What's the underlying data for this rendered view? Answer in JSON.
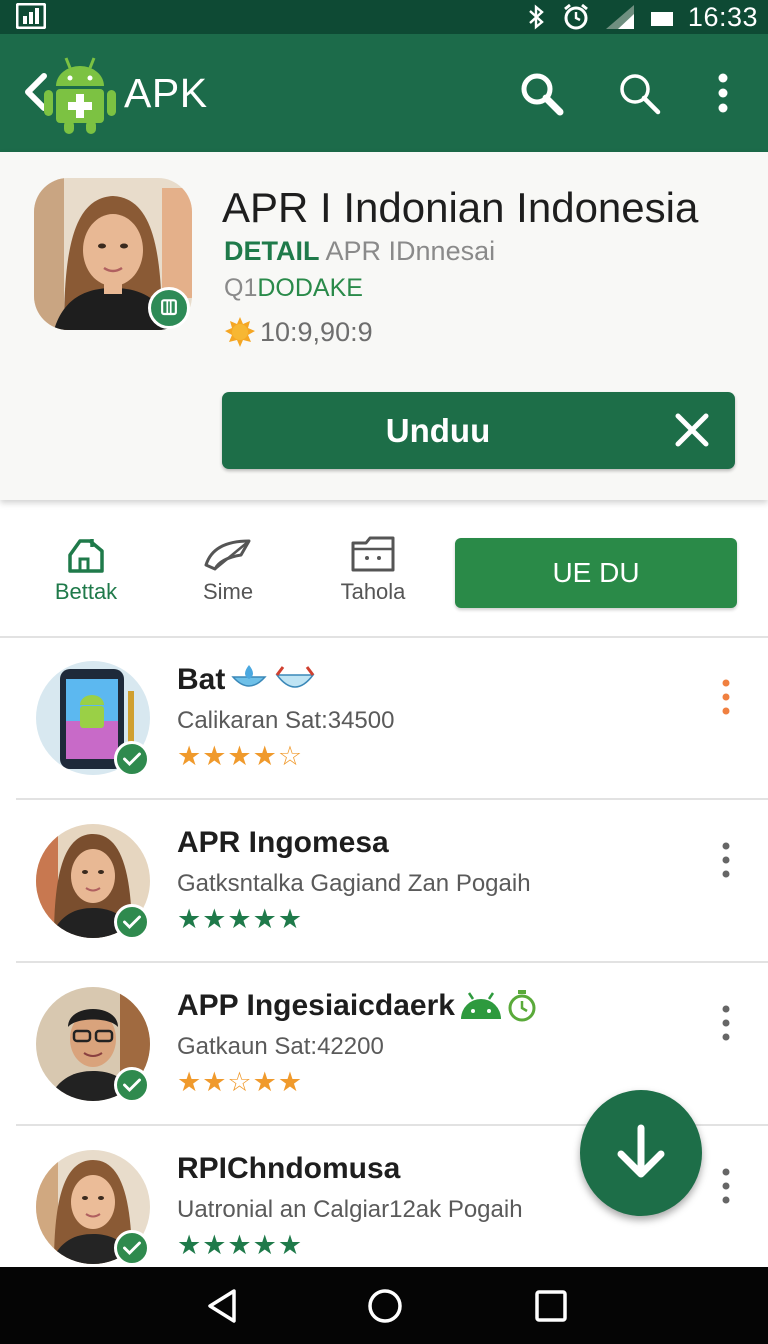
{
  "status_bar": {
    "time": "16:33",
    "icons": [
      "gallery-icon",
      "bluetooth-icon",
      "alarm-icon",
      "signal-icon",
      "battery-icon"
    ]
  },
  "app_bar": {
    "title": "APK",
    "icons": [
      "back-icon",
      "android-logo-icon",
      "search-icon",
      "search-icon",
      "more-vert-icon"
    ]
  },
  "detail": {
    "app_name": "APR I Indonian Indonesia",
    "detail_label": "DETAIL",
    "detail_sub": "APR IDnnesai",
    "version_prefix": "Q1",
    "version_label": "DODAKE",
    "size": "10:9,90:9",
    "download_button": "Unduu"
  },
  "tabs": [
    {
      "label": "Bettak",
      "icon": "home-icon"
    },
    {
      "label": "Sime",
      "icon": "send-icon"
    },
    {
      "label": "Tahola",
      "icon": "folder-icon"
    }
  ],
  "action_button": "UE DU",
  "list": [
    {
      "title": "Bat",
      "subtitle": "Calikaran Sat:34500",
      "stars": "★★★★☆",
      "rating": 4
    },
    {
      "title": "APR Ingomesa",
      "subtitle": "Gatksntalka Gagiand Zan Pogaih",
      "stars": "★★★★★",
      "rating": 5
    },
    {
      "title": "APP Ingesiaicdaerk",
      "subtitle": "Gatkaun Sat:42200",
      "stars": "★★☆★★",
      "rating": 3.5
    },
    {
      "title": "RPIChndomusa",
      "subtitle": "Uatronial an Calgiar12ak Pogaih",
      "stars": "★★★★★",
      "rating": 5
    }
  ],
  "colors": {
    "status_bar": "#0e4a34",
    "app_bar": "#1c6b4a",
    "primary_button": "#1d6e48",
    "accent_green": "#2a8a48",
    "star_orange": "#f09a2c",
    "star_green": "#1f7a4a"
  }
}
